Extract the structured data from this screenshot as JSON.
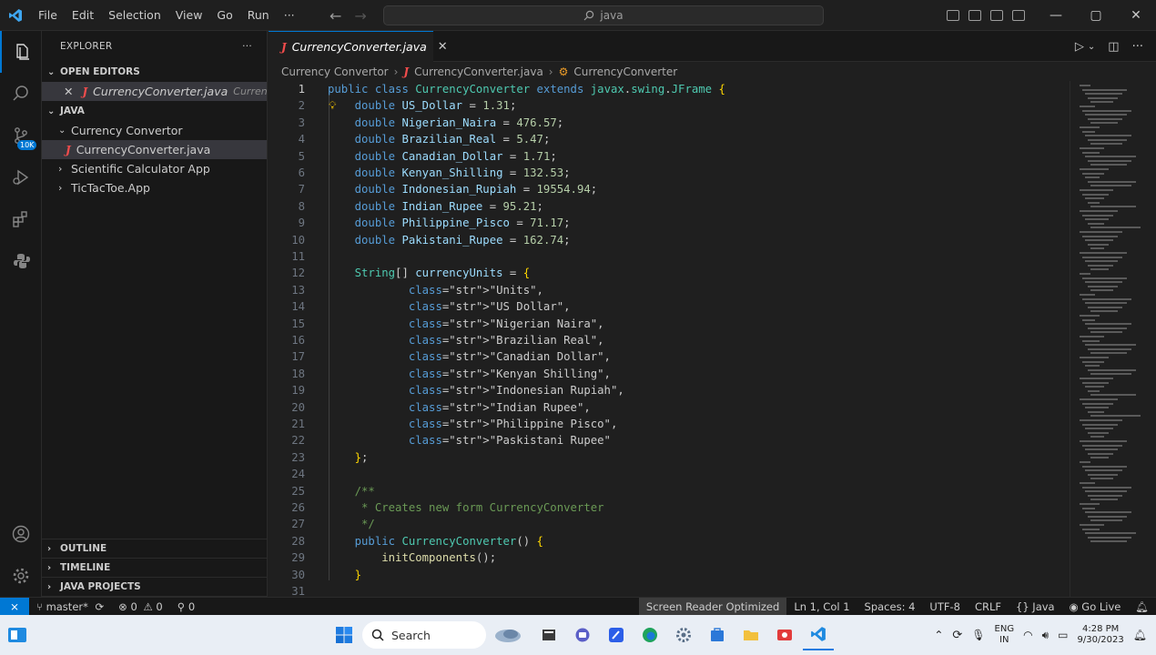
{
  "titlebar": {
    "menu": [
      "File",
      "Edit",
      "Selection",
      "View",
      "Go",
      "Run",
      "···"
    ],
    "search": "java"
  },
  "activitybar": {
    "source_control_badge": "10K"
  },
  "sidebar": {
    "title": "EXPLORER",
    "more": "···",
    "open_editors_label": "OPEN EDITORS",
    "open_editor": {
      "name": "CurrencyConverter.java",
      "path": "Currenc..."
    },
    "java_label": "JAVA",
    "tree": [
      {
        "label": "Currency Convertor"
      },
      {
        "label": "CurrencyConverter.java"
      },
      {
        "label": "Scientific Calculator App"
      },
      {
        "label": "TicTacToe.App"
      }
    ],
    "bottom_sections": [
      "OUTLINE",
      "TIMELINE",
      "JAVA PROJECTS"
    ]
  },
  "editor": {
    "tab": "CurrencyConverter.java",
    "breadcrumb": [
      "Currency Convertor",
      "CurrencyConverter.java",
      "CurrencyConverter"
    ],
    "line_numbers": [
      "1",
      "2",
      "3",
      "4",
      "5",
      "6",
      "7",
      "8",
      "9",
      "10",
      "11",
      "12",
      "13",
      "14",
      "15",
      "16",
      "17",
      "18",
      "19",
      "20",
      "21",
      "22",
      "23",
      "24",
      "25",
      "26",
      "27",
      "28",
      "29",
      "30",
      "31"
    ],
    "lines": [
      "public class CurrencyConverter extends javax.swing.JFrame {",
      "    double US_Dollar = 1.31;",
      "    double Nigerian_Naira = 476.57;",
      "    double Brazilian_Real = 5.47;",
      "    double Canadian_Dollar = 1.71;",
      "    double Kenyan_Shilling = 132.53;",
      "    double Indonesian_Rupiah = 19554.94;",
      "    double Indian_Rupee = 95.21;",
      "    double Philippine_Pisco = 71.17;",
      "    double Pakistani_Rupee = 162.74;",
      "",
      "    String[] currencyUnits = {",
      "            \"Units\",",
      "            \"US Dollar\",",
      "            \"Nigerian Naira\",",
      "            \"Brazilian Real\",",
      "            \"Canadian Dollar\",",
      "            \"Kenyan Shilling\",",
      "            \"Indonesian Rupiah\",",
      "            \"Indian Rupee\",",
      "            \"Philippine Pisco\",",
      "            \"Paskistani Rupee\"",
      "    };",
      "",
      "    /**",
      "     * Creates new form CurrencyConverter",
      "     */",
      "    public CurrencyConverter() {",
      "        initComponents();",
      "    }",
      ""
    ]
  },
  "statusbar": {
    "branch": "master*",
    "errors": "0",
    "warnings": "0",
    "ports": "0",
    "screen_reader": "Screen Reader Optimized",
    "position": "Ln 1, Col 1",
    "spaces": "Spaces: 4",
    "encoding": "UTF-8",
    "eol": "CRLF",
    "language": "Java",
    "golive": "Go Live"
  },
  "taskbar": {
    "search": "Search",
    "lang": "ENG",
    "region": "IN",
    "time": "4:28 PM",
    "date": "9/30/2023"
  },
  "colors": {
    "accent": "#0078d4",
    "java_icon": "#f14c4c"
  }
}
